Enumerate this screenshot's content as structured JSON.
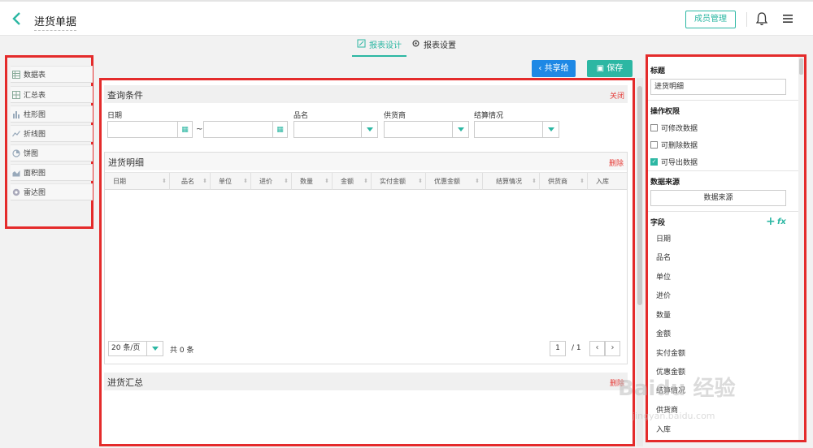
{
  "header": {
    "title": "进货单据",
    "member_button": "成员管理"
  },
  "tabs": [
    {
      "label": "报表设计",
      "active": true
    },
    {
      "label": "报表设置",
      "active": false
    }
  ],
  "left_panel": {
    "items": [
      {
        "label": "数据表",
        "icon": "table-icon"
      },
      {
        "label": "汇总表",
        "icon": "summary-table-icon"
      },
      {
        "label": "柱形图",
        "icon": "bar-chart-icon"
      },
      {
        "label": "折线图",
        "icon": "line-chart-icon"
      },
      {
        "label": "饼图",
        "icon": "pie-chart-icon"
      },
      {
        "label": "面积图",
        "icon": "area-chart-icon"
      },
      {
        "label": "雷达图",
        "icon": "radar-chart-icon"
      }
    ]
  },
  "toolbar": {
    "share_label": "共享给",
    "save_label": "保存"
  },
  "query": {
    "title": "查询条件",
    "close_label": "关闭",
    "date_label": "日期",
    "date_sep": "~",
    "product_label": "品名",
    "supplier_label": "供货商",
    "settlement_label": "结算情况"
  },
  "detail": {
    "title": "进货明细",
    "delete_label": "删除",
    "columns": [
      "日期",
      "品名",
      "单位",
      "进价",
      "数量",
      "金额",
      "实付金额",
      "优惠金额",
      "结算情况",
      "供货商",
      "入库"
    ],
    "page_size": "20 条/页",
    "total": "共 0 条",
    "current_page": "1",
    "page_total": "/ 1",
    "prev": "‹",
    "next": "›"
  },
  "summary": {
    "title": "进货汇总",
    "delete_label": "删除"
  },
  "right_panel": {
    "title_label": "标题",
    "title_value": "进货明细",
    "permissions_label": "操作权限",
    "permissions": [
      {
        "label": "可修改数据",
        "checked": false
      },
      {
        "label": "可删除数据",
        "checked": false
      },
      {
        "label": "可导出数据",
        "checked": true
      }
    ],
    "datasource_label": "数据来源",
    "datasource_button": "数据来源",
    "fields_label": "字段",
    "fx_label": "fx",
    "fields": [
      "日期",
      "品名",
      "单位",
      "进价",
      "数量",
      "金额",
      "实付金额",
      "优惠金额",
      "结算情况",
      "供货商",
      "入库"
    ]
  },
  "watermark": {
    "main": "Baidu 经验",
    "sub": "jingyan.baidu.com"
  },
  "colors": {
    "accent": "#2cb7a3",
    "share": "#1e88e5",
    "highlight_border": "#e42b2b",
    "danger_text": "#e53935"
  }
}
